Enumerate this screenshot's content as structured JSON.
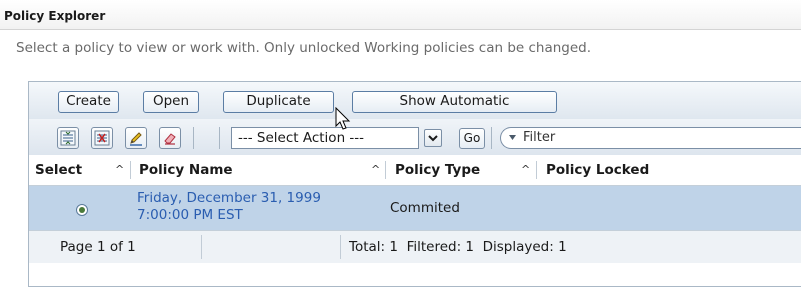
{
  "window": {
    "title": "Policy Explorer"
  },
  "description": "Select a policy to view or work with. Only unlocked Working policies can be changed.",
  "buttons": {
    "create": "Create",
    "open": "Open",
    "duplicate": "Duplicate",
    "show_automatic": "Show Automatic"
  },
  "toolbar": {
    "icons": [
      "select-all-icon",
      "deselect-all-icon",
      "edit-pencil-icon",
      "eraser-icon"
    ],
    "action_select": "--- Select Action ---",
    "go_label": "Go",
    "filter_value": "Filter"
  },
  "table": {
    "columns": [
      "Select",
      "Policy Name",
      "Policy Type",
      "Policy Locked"
    ],
    "rows": [
      {
        "selected": true,
        "policy_name_line1": "Friday, December 31, 1999",
        "policy_name_line2": "7:00:00 PM EST",
        "policy_type": "Commited",
        "policy_locked": ""
      }
    ]
  },
  "footer": {
    "page": "Page 1 of 1",
    "total": "Total: 1",
    "filtered": "Filtered: 1",
    "displayed": "Displayed: 1"
  },
  "colors": {
    "selected_row": "#bfd3e8",
    "link": "#2a5db0",
    "button_border": "#5b7da4"
  }
}
